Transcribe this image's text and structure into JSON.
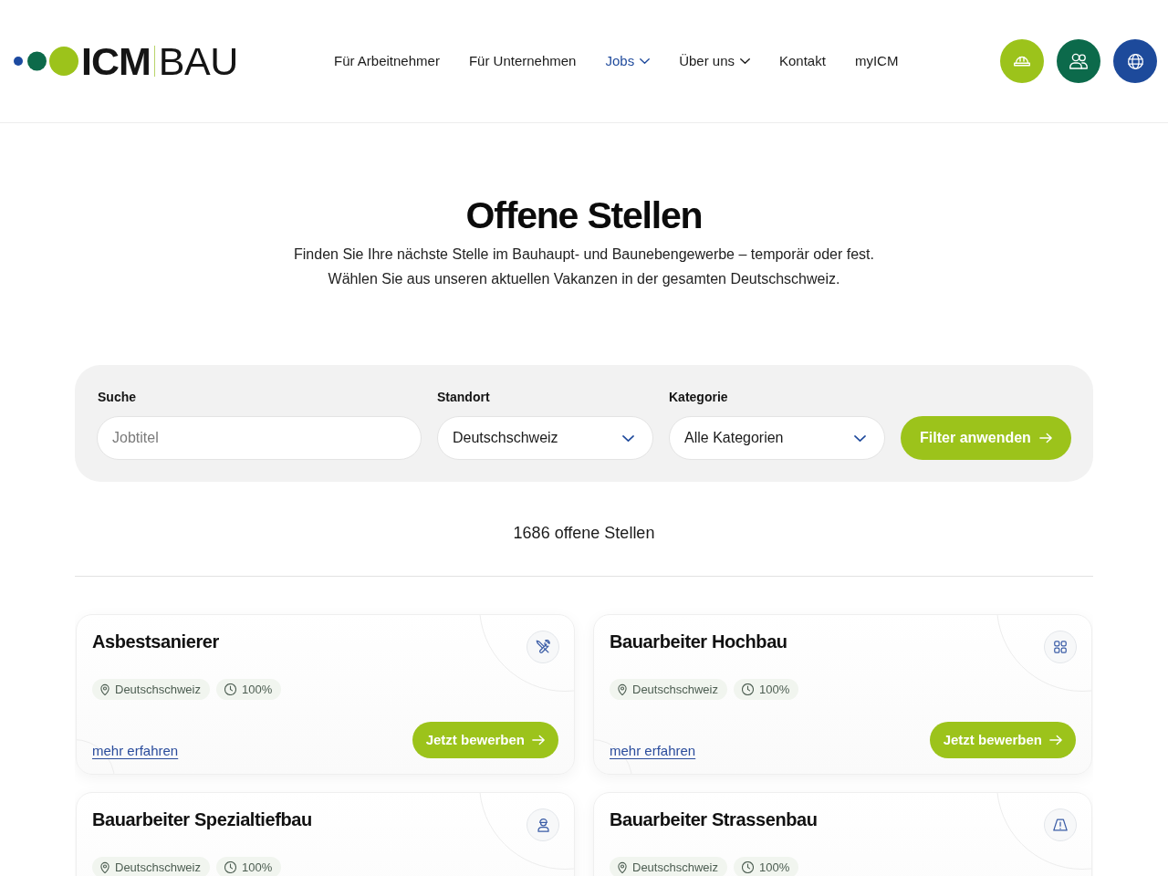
{
  "header": {
    "logo": {
      "bold": "ICM",
      "light": "BAU"
    },
    "nav": [
      {
        "label": "Für Arbeitnehmer",
        "selected": false,
        "dropdown": false
      },
      {
        "label": "Für Unternehmen",
        "selected": false,
        "dropdown": false
      },
      {
        "label": "Jobs",
        "selected": true,
        "dropdown": true
      },
      {
        "label": "Über uns",
        "selected": false,
        "dropdown": true
      },
      {
        "label": "Kontakt",
        "selected": false,
        "dropdown": false
      },
      {
        "label": "myICM",
        "selected": false,
        "dropdown": false
      }
    ]
  },
  "hero": {
    "title": "Offene Stellen",
    "lines": [
      "Finden Sie Ihre nächste Stelle im Bauhaupt- und Baunebengewerbe –  temporär oder fest.",
      "Wählen Sie aus unseren aktuellen Vakanzen in der  gesamten Deutschschweiz."
    ]
  },
  "filters": {
    "search": {
      "label": "Suche",
      "placeholder": "Jobtitel"
    },
    "location": {
      "label": "Standort",
      "value": "Deutschschweiz"
    },
    "category": {
      "label": "Kategorie",
      "value": "Alle Kategorien"
    },
    "apply_button": "Filter anwenden"
  },
  "results_count": "1686 offene Stellen",
  "jobs": [
    {
      "title": "Asbestsanierer",
      "kind": "tools",
      "location": "Deutschschweiz",
      "workload": "100%",
      "details_link": "mehr erfahren",
      "apply_button": "Jetzt bewerben"
    },
    {
      "title": "Bauarbeiter Hochbau",
      "kind": "grid",
      "location": "Deutschschweiz",
      "workload": "100%",
      "details_link": "mehr erfahren",
      "apply_button": "Jetzt bewerben"
    },
    {
      "title": "Bauarbeiter Spezialtiefbau",
      "kind": "worker",
      "location": "Deutschschweiz",
      "workload": "100%"
    },
    {
      "title": "Bauarbeiter Strassenbau",
      "kind": "road",
      "location": "Deutschschweiz",
      "workload": "100%"
    }
  ]
}
